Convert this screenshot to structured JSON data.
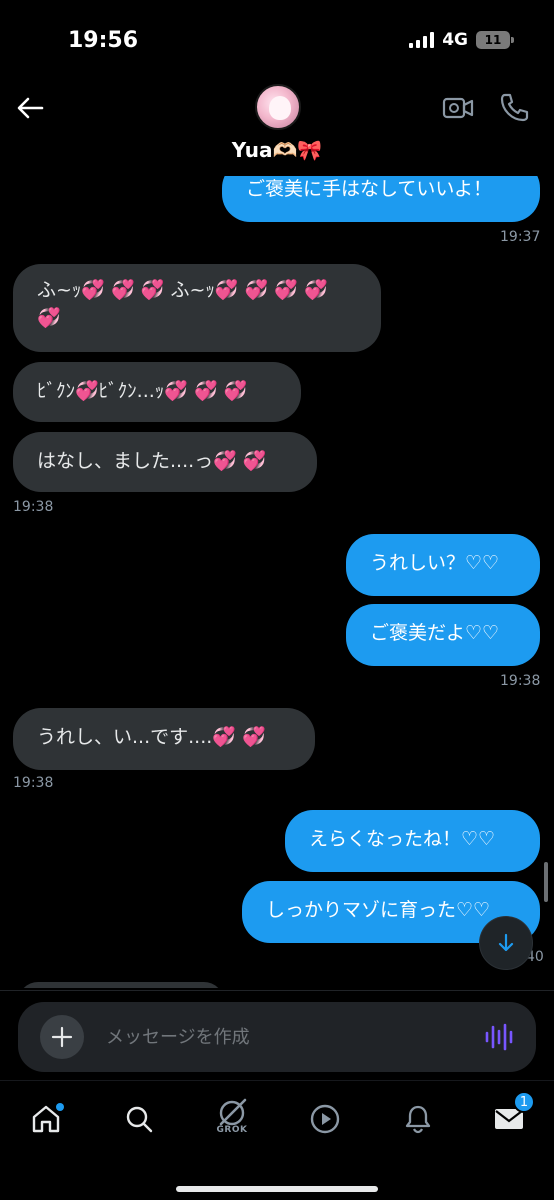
{
  "status_bar": {
    "time": "19:56",
    "network": "4G",
    "battery": "11"
  },
  "header": {
    "contact_name": "Yua🫶🏻🎀",
    "back_icon": "arrow-left-icon",
    "video_icon": "video-camera-icon",
    "call_icon": "phone-icon"
  },
  "messages": [
    {
      "direction": "out",
      "text": "ご褒美に手はなしていいよ！"
    },
    {
      "timestamp": "19:37"
    },
    {
      "direction": "in",
      "text_line1": "ふ~ｯ💞 💞 💞 ふ~ｯ💞 💞 💞 💞",
      "text_line2": "💞"
    },
    {
      "direction": "in",
      "text": "ﾋﾞｸﾝ💞ﾋﾞｸﾝ...ｯ💞 💞 💞"
    },
    {
      "direction": "in",
      "text": "はなし、ました....っ💞 💞"
    },
    {
      "timestamp": "19:38"
    },
    {
      "direction": "out",
      "text": "うれしい？♡♡"
    },
    {
      "direction": "out",
      "text": "ご褒美だよ♡♡"
    },
    {
      "timestamp": "19:38"
    },
    {
      "direction": "in",
      "text": "うれし、い...です....💞 💞"
    },
    {
      "timestamp": "19:38"
    },
    {
      "direction": "out",
      "text": "えらくなったね！♡♡"
    },
    {
      "direction": "out",
      "text": "しっかりマゾに育った♡♡"
    },
    {
      "timestamp_partial": "40"
    }
  ],
  "compose": {
    "placeholder": "メッセージを作成"
  },
  "nav": {
    "grok_label": "GROK",
    "messages_badge": "1"
  },
  "colors": {
    "outgoing_bubble": "#1d9bf0",
    "incoming_bubble": "#2f3336",
    "background": "#000000",
    "voice_icon": "#7856ff"
  }
}
